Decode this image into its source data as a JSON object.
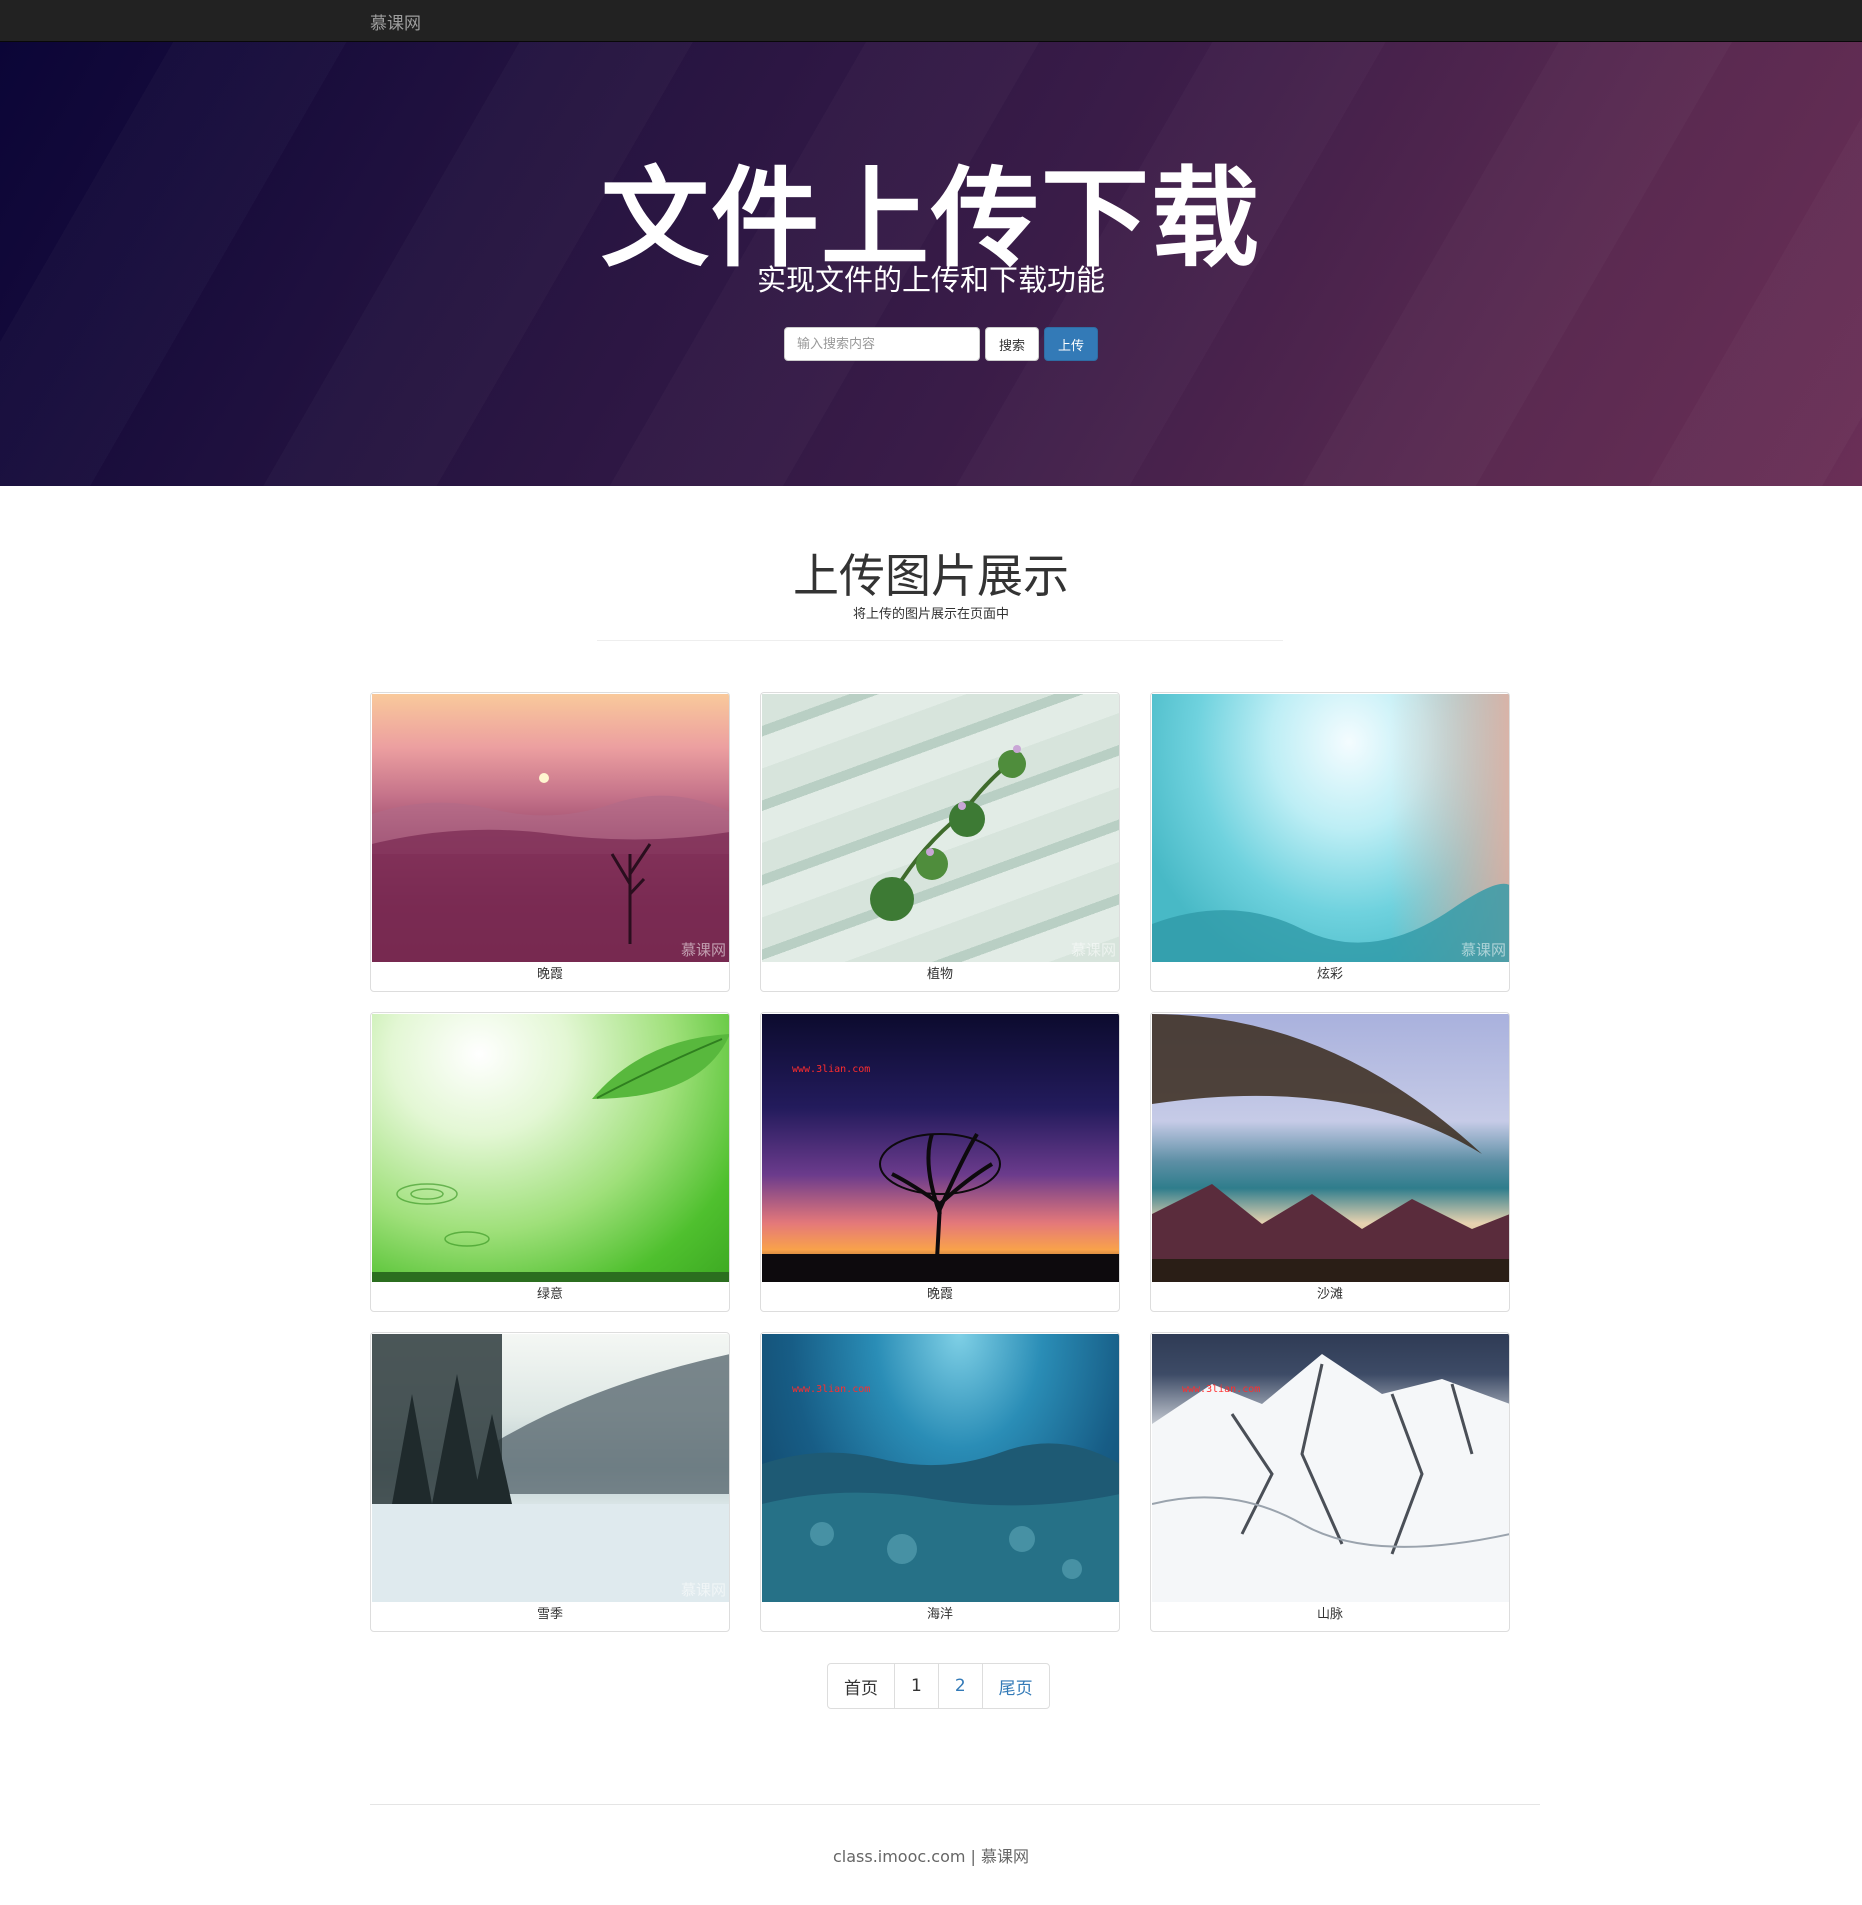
{
  "navbar": {
    "brand": "慕课网"
  },
  "hero": {
    "title": "文件上传下载",
    "subtitle": "实现文件的上传和下载功能",
    "search_placeholder": "输入搜索内容",
    "search_button": "搜索",
    "upload_button": "上传"
  },
  "section": {
    "title": "上传图片展示",
    "subtitle": "将上传的图片展示在页面中"
  },
  "gallery": [
    {
      "caption": "晚霞",
      "watermark": "慕课网"
    },
    {
      "caption": "植物",
      "watermark": "慕课网"
    },
    {
      "caption": "炫彩",
      "watermark": "慕课网"
    },
    {
      "caption": "绿意",
      "watermark": ""
    },
    {
      "caption": "晚霞",
      "watermark": "www.3lian.com"
    },
    {
      "caption": "沙滩",
      "watermark": ""
    },
    {
      "caption": "雪季",
      "watermark": "慕课网"
    },
    {
      "caption": "海洋",
      "watermark": "www.3lian.com"
    },
    {
      "caption": "山脉",
      "watermark": "www.3lian.com"
    }
  ],
  "pagination": {
    "first": "首页",
    "pages": [
      "1",
      "2"
    ],
    "last": "尾页"
  },
  "footer": {
    "text": "class.imooc.com | 慕课网"
  }
}
